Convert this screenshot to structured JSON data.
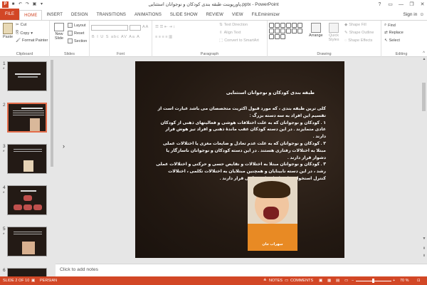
{
  "titlebar": {
    "title": "پاورپوینت طبقه بندی کودکان و نوجوانان استثنایی.pptx - PowerPoint",
    "app_icon": "P",
    "buttons": [
      "?",
      "▭",
      "—",
      "❐",
      "✕"
    ]
  },
  "tabs": {
    "items": [
      "FILE",
      "HOME",
      "INSERT",
      "DESIGN",
      "TRANSITIONS",
      "ANIMATIONS",
      "SLIDE SHOW",
      "REVIEW",
      "VIEW",
      "FILEminimizer"
    ],
    "active": "HOME",
    "signin": "Sign in"
  },
  "ribbon": {
    "clipboard": {
      "paste": "Paste",
      "cut": "Cut",
      "copy": "Copy",
      "format_painter": "Format Painter",
      "label": "Clipboard"
    },
    "slides": {
      "new_slide": "New Slide",
      "layout": "Layout",
      "reset": "Reset",
      "section": "Section",
      "label": "Slides"
    },
    "font": {
      "label": "Font",
      "format_row": "B  I  U  S  abc  AV  Aa  A"
    },
    "paragraph": {
      "text_direction": "Text Direction",
      "align_text": "Align Text",
      "convert_smartart": "Convert to SmartArt",
      "label": "Paragraph"
    },
    "drawing": {
      "arrange": "Arrange",
      "quick_styles": "Quick Styles",
      "shape_fill": "Shape Fill",
      "shape_outline": "Shape Outline",
      "shape_effects": "Shape Effects",
      "label": "Drawing"
    },
    "editing": {
      "find": "Find",
      "replace": "Replace",
      "select": "Select",
      "label": "Editing"
    }
  },
  "thumbnails": [
    {
      "num": "1",
      "star": "*"
    },
    {
      "num": "2",
      "star": ""
    },
    {
      "num": "3",
      "star": "*"
    },
    {
      "num": "4",
      "star": "*"
    },
    {
      "num": "5",
      "star": "*"
    },
    {
      "num": "6",
      "star": ""
    }
  ],
  "slide": {
    "title": "طبقه بندی کودکان و نوجوانان استثنایی",
    "paragraphs": [
      "کلی ترین طبقه بندی ، که مورد قبول اکثریت متخصصان می باشد عبارت است از تقسیم این افراد به سه دسته بزرگ :",
      "۱ . کودکان و نوجوانان که به علت اختلافات هوشی و فعالیتهای ذهنی از کودکان عادی متمایزند . در این دسته کودکان عقب ماندهٔ ذهنی و افراد تیز هوش قرار دارند .",
      "۲ . کودکان و نوجوانان که به علت عدم تعادل و ضایعات مغزی یا اختلالات عملی مبتلا به اختلالات رفتاری هستند . در این دسته کودکان و نوجوانان ناسازگار یا دشوار قرار دارند .",
      "۳ . کودکان و نوجوانان مبتلا به اختلالات و نقایص حسی و حرکتی و اختلالات عملی رشد ، در این دسته نابینایان و همچنین مبتلایان به اختلالات تکلمی ، اختلالات کنترل استخوان ها و ناتوانیهای حرکتی قرار دارند ."
    ],
    "photo_caption": "سهراب جان"
  },
  "notes": {
    "placeholder": "Click to add notes"
  },
  "status": {
    "slide_info": "SLIDE 2 OF 10",
    "language": "PERSIAN",
    "notes": "NOTES",
    "comments": "COMMENTS",
    "zoom": "70 %"
  }
}
